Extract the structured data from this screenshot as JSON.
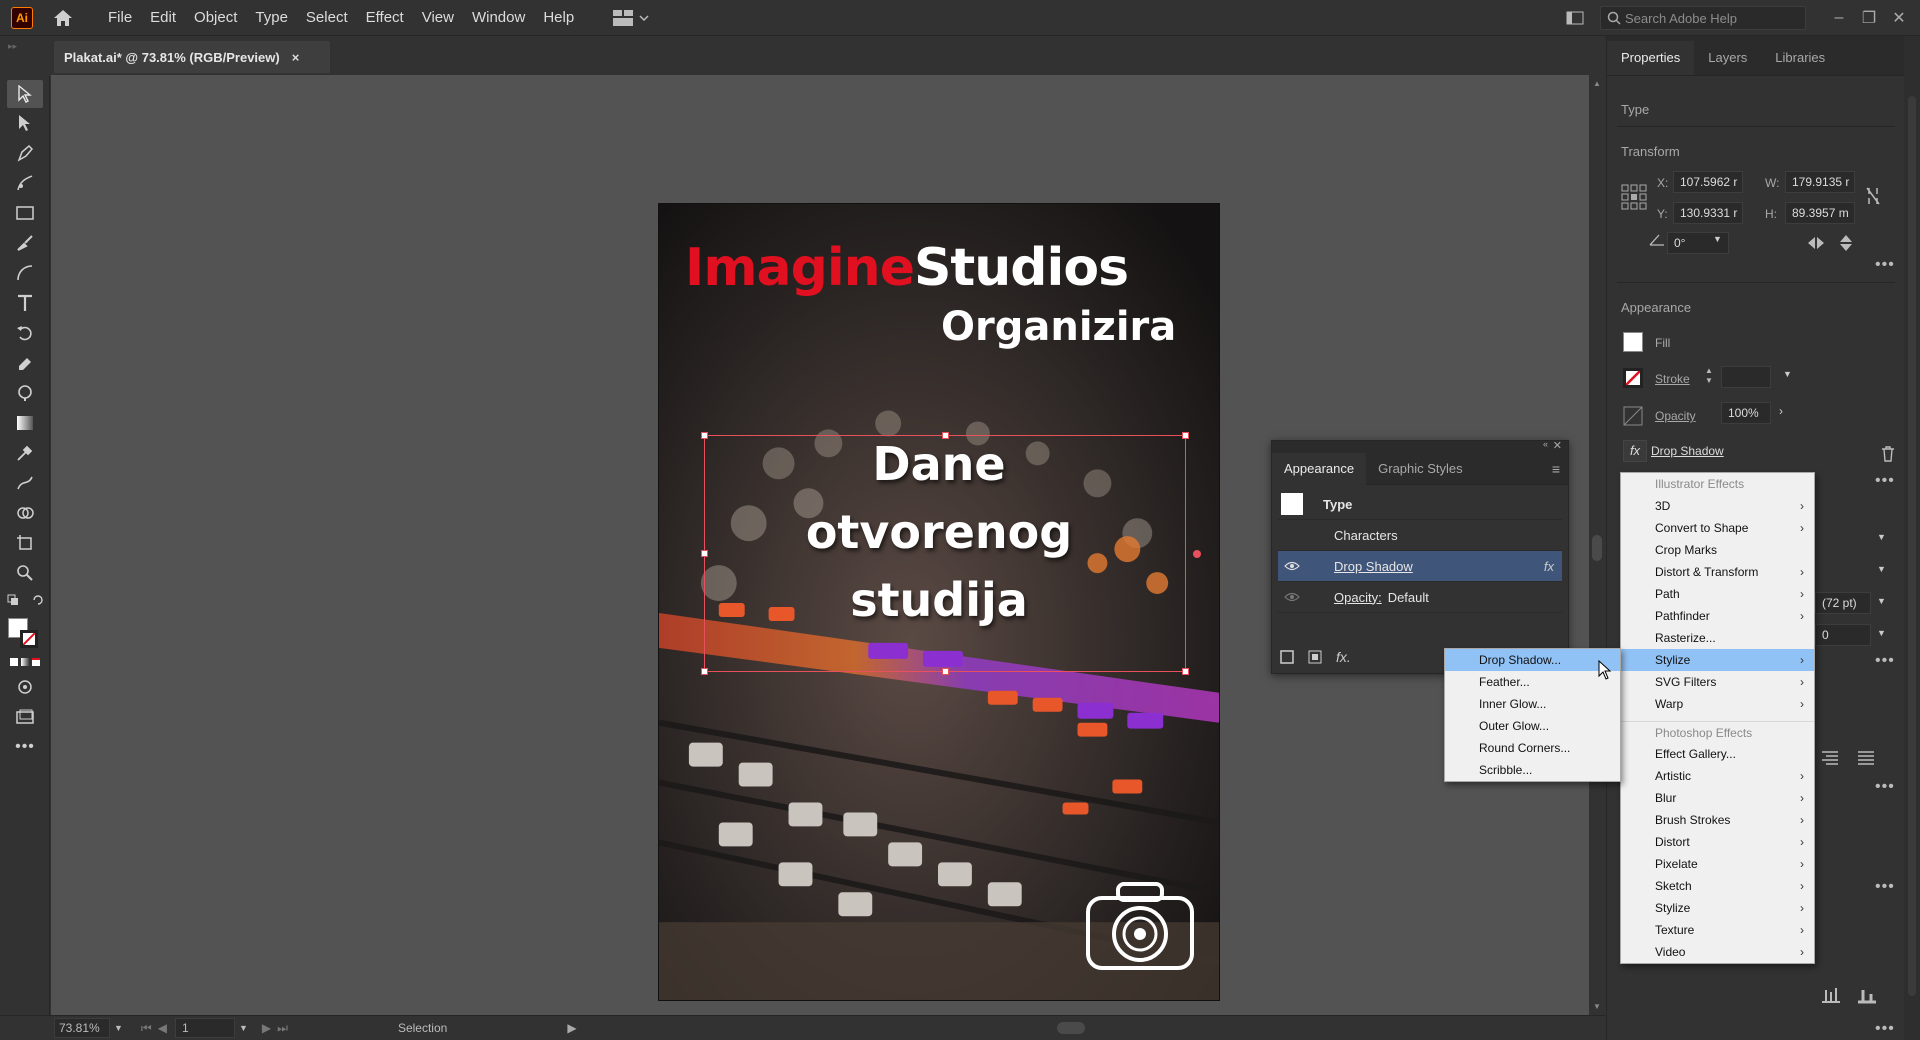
{
  "app": {
    "logo_text": "Ai",
    "menu": [
      "File",
      "Edit",
      "Object",
      "Type",
      "Select",
      "Effect",
      "View",
      "Window",
      "Help"
    ],
    "search_placeholder": "Search Adobe Help"
  },
  "document": {
    "tab_title": "Plakat.ai* @ 73.81% (RGB/Preview)",
    "close_glyph": "×"
  },
  "artboard": {
    "title_red": "Imagine",
    "title_white": "Studios",
    "subtitle": "Organizira",
    "headline": [
      "Dane",
      "otvorenog",
      "studija"
    ]
  },
  "status": {
    "zoom": "73.81%",
    "artboard_number": "1",
    "current_tool": "Selection"
  },
  "properties": {
    "tabs": [
      "Properties",
      "Layers",
      "Libraries"
    ],
    "object_type": "Type",
    "transform": {
      "title": "Transform",
      "x_label": "X:",
      "x": "107.5962 r",
      "y_label": "Y:",
      "y": "130.9331 r",
      "w_label": "W:",
      "w": "179.9135 r",
      "h_label": "H:",
      "h": "89.3957 m",
      "angle": "0°"
    },
    "appearance": {
      "title": "Appearance",
      "fill_label": "Fill",
      "stroke_label": "Stroke",
      "opacity_label": "Opacity",
      "opacity_value": "100%",
      "effect_label": "Drop Shadow",
      "leading_value": "(72 pt)",
      "tracking_value": "0"
    }
  },
  "appearance_panel": {
    "tabs": [
      "Appearance",
      "Graphic Styles"
    ],
    "rows": {
      "type": "Type",
      "characters": "Characters",
      "drop_shadow": "Drop Shadow",
      "opacity_label": "Opacity:",
      "opacity_value": "Default"
    }
  },
  "effects_menu": {
    "illustrator_header": "Illustrator Effects",
    "illustrator_items": [
      "3D",
      "Convert to Shape",
      "Crop Marks",
      "Distort & Transform",
      "Path",
      "Pathfinder",
      "Rasterize...",
      "Stylize",
      "SVG Filters",
      "Warp"
    ],
    "illustrator_has_submenu": [
      true,
      true,
      false,
      true,
      true,
      true,
      false,
      true,
      true,
      true
    ],
    "photoshop_header": "Photoshop Effects",
    "photoshop_items": [
      "Effect Gallery...",
      "Artistic",
      "Blur",
      "Brush Strokes",
      "Distort",
      "Pixelate",
      "Sketch",
      "Stylize",
      "Texture",
      "Video"
    ],
    "photoshop_has_submenu": [
      false,
      true,
      true,
      true,
      true,
      true,
      true,
      true,
      true,
      true
    ],
    "highlighted": "Stylize"
  },
  "stylize_submenu": {
    "items": [
      "Drop Shadow...",
      "Feather...",
      "Inner Glow...",
      "Outer Glow...",
      "Round Corners...",
      "Scribble..."
    ],
    "highlighted": "Drop Shadow..."
  },
  "colors": {
    "accent_red": "#e01020",
    "selection_red": "#e8505b",
    "menu_highlight": "#91c2f5",
    "row_selected": "#3f5579"
  }
}
